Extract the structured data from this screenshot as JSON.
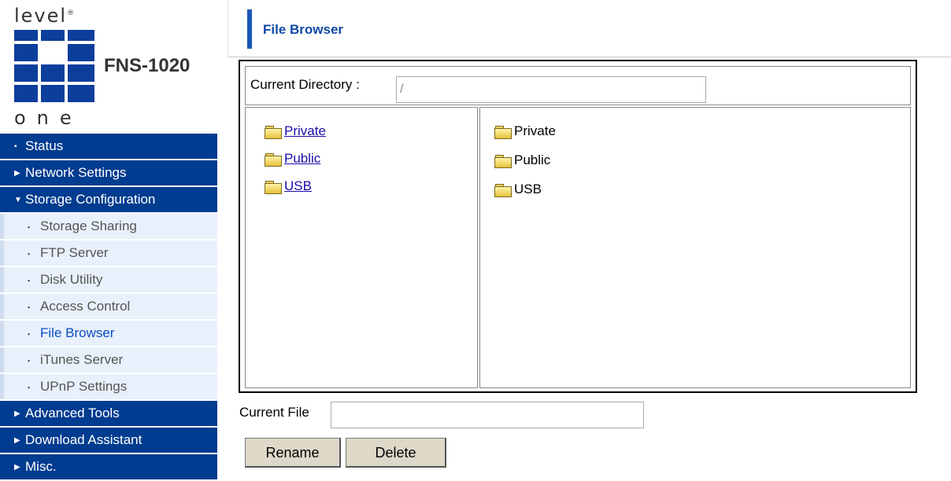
{
  "brand": {
    "top": "level",
    "bottom": "one",
    "model": "FNS-1020"
  },
  "colors": {
    "nav_bg": "#003c8f",
    "sub_bg": "#e8f0fb",
    "accent": "#1a56b5"
  },
  "sidebar": {
    "items": [
      {
        "label": "Status",
        "mark": "▪",
        "type": "nav"
      },
      {
        "label": "Network Settings",
        "mark": "▶",
        "type": "nav"
      },
      {
        "label": "Storage Configuration",
        "mark": "▼",
        "type": "nav"
      },
      {
        "label": "Storage Sharing",
        "mark": "▪",
        "type": "sub"
      },
      {
        "label": "FTP Server",
        "mark": "▪",
        "type": "sub"
      },
      {
        "label": "Disk Utility",
        "mark": "▪",
        "type": "sub"
      },
      {
        "label": "Access Control",
        "mark": "▪",
        "type": "sub"
      },
      {
        "label": "File Browser",
        "mark": "▪",
        "type": "sub",
        "active": true
      },
      {
        "label": "iTunes Server",
        "mark": "▪",
        "type": "sub"
      },
      {
        "label": "UPnP Settings",
        "mark": "▪",
        "type": "sub"
      },
      {
        "label": "Advanced Tools",
        "mark": "▶",
        "type": "nav"
      },
      {
        "label": "Download Assistant",
        "mark": "▶",
        "type": "nav"
      },
      {
        "label": "Misc.",
        "mark": "▶",
        "type": "nav"
      }
    ]
  },
  "header": {
    "title": "File Browser"
  },
  "browser": {
    "current_directory_label": "Current Directory :",
    "current_directory_value": "/",
    "tree": [
      {
        "label": "Private"
      },
      {
        "label": "Public"
      },
      {
        "label": "USB"
      }
    ],
    "contents": [
      {
        "label": "Private"
      },
      {
        "label": "Public"
      },
      {
        "label": "USB"
      }
    ]
  },
  "file": {
    "label": "Current File",
    "value": ""
  },
  "buttons": {
    "rename": "Rename",
    "delete": "Delete"
  }
}
